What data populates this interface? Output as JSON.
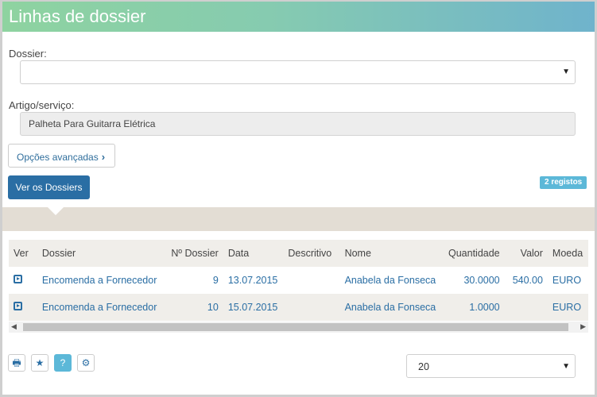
{
  "window": {
    "title": "Linhas de dossier"
  },
  "form": {
    "dossier_label": "Dossier:",
    "dossier_value": "",
    "artigo_label": "Artigo/serviço:",
    "artigo_value": "Palheta Para Guitarra Elétrica",
    "advanced_label": "Opções avançadas",
    "view_dossiers_label": "Ver os Dossiers",
    "records_badge": "2 registos"
  },
  "table": {
    "headers": [
      "Ver",
      "Dossier",
      "Nº Dossier",
      "Data",
      "Descritivo",
      "Nome",
      "Quantidade",
      "Valor",
      "Moeda"
    ],
    "rows": [
      {
        "dossier": "Encomenda a Fornecedor",
        "num": "9",
        "data": "13.07.2015",
        "descritivo": "",
        "nome": "Anabela da Fonseca",
        "quantidade": "30.0000",
        "valor": "540.00",
        "moeda": "EURO"
      },
      {
        "dossier": "Encomenda a Fornecedor",
        "num": "10",
        "data": "15.07.2015",
        "descritivo": "",
        "nome": "Anabela da Fonseca",
        "quantidade": "1.0000",
        "valor": "",
        "moeda": "EURO"
      }
    ]
  },
  "footer": {
    "page_size": "20",
    "icons": [
      "print-icon",
      "star-icon",
      "help-icon",
      "gear-icon"
    ]
  },
  "colors": {
    "primary": "#2a6ea4",
    "badge": "#5cb8d8",
    "band": "#e3ddd4"
  }
}
